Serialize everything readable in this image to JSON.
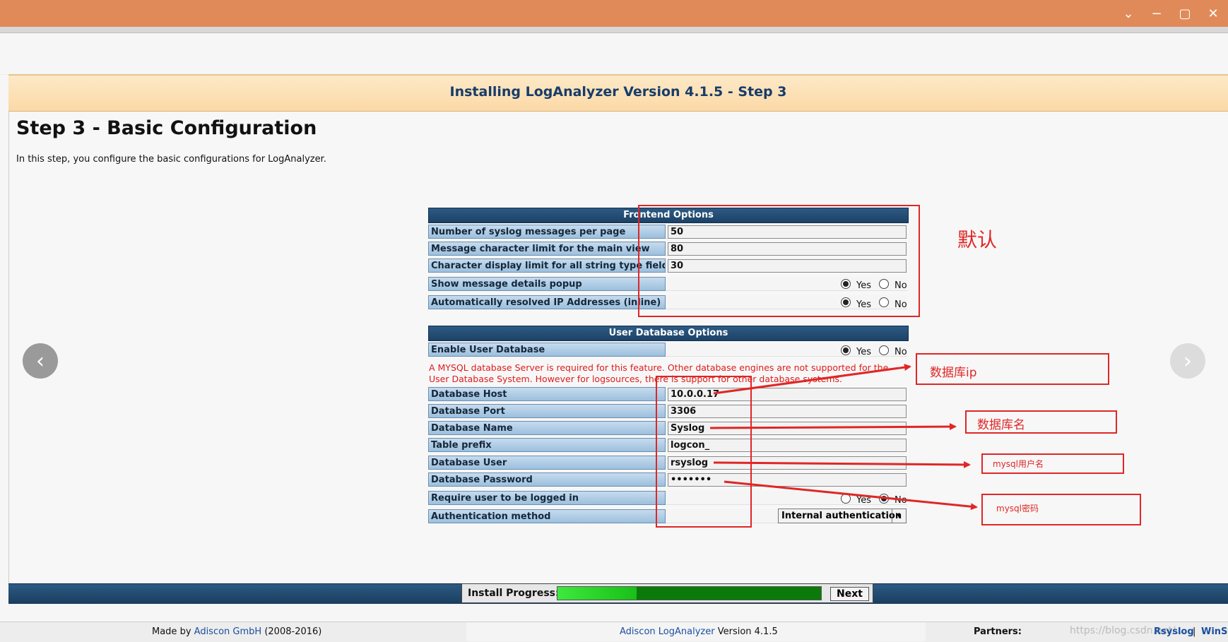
{
  "window": {
    "minimize_icon": "−",
    "restore_icon": "▢",
    "close_icon": "✕",
    "collapse_icon": "⌄"
  },
  "header": {
    "title": "Installing LogAnalyzer Version 4.1.5 - Step 3"
  },
  "page": {
    "heading": "Step 3 - Basic Configuration",
    "intro": "In this step, you configure the basic configurations for LogAnalyzer."
  },
  "frontend": {
    "title": "Frontend Options",
    "rows": [
      {
        "label": "Number of syslog messages per page",
        "value": "50"
      },
      {
        "label": "Message character limit for the main view",
        "value": "80"
      },
      {
        "label": "Character display limit for all string type fields",
        "value": "30"
      }
    ],
    "popup": {
      "label": "Show message details popup",
      "selected": "Yes"
    },
    "resolve": {
      "label": "Automatically resolved IP Addresses (inline)",
      "selected": "Yes"
    },
    "yes": "Yes",
    "no": "No"
  },
  "userdb": {
    "title": "User Database Options",
    "enable": {
      "label": "Enable User Database",
      "selected": "Yes"
    },
    "warning": "A MYSQL database Server is required for this feature. Other database engines are not supported for the User Database System. However for logsources, there is support for other database systems.",
    "rows": [
      {
        "label": "Database Host",
        "value": "10.0.0.17"
      },
      {
        "label": "Database Port",
        "value": "3306"
      },
      {
        "label": "Database Name",
        "value": "Syslog"
      },
      {
        "label": "Table prefix",
        "value": "logcon_"
      },
      {
        "label": "Database User",
        "value": "rsyslog"
      },
      {
        "label": "Database Password",
        "value": "•••••••"
      }
    ],
    "require": {
      "label": "Require user to be logged in",
      "selected": "No"
    },
    "auth": {
      "label": "Authentication method",
      "value": "Internal authentication"
    }
  },
  "progress": {
    "label": "Install Progress:",
    "fraction": 0.3,
    "next_label": "Next"
  },
  "footer": {
    "made_by_prefix": "Made by",
    "company": "Adiscon GmbH",
    "years": "(2008-2016)",
    "product": "Adiscon LogAnalyzer",
    "version": "Version 4.1.5",
    "partners_label": "Partners:",
    "partner1": "Rsyslog",
    "separator": "|",
    "partner2": "WinSy",
    "watermark": "https://blog.csdn.net/..."
  },
  "annotations": {
    "default_label": "默认",
    "db_ip": "数据库ip",
    "db_name": "数据库名",
    "mysql_user": "mysql用户名",
    "mysql_pass": "mysql密码"
  },
  "nav": {
    "prev_icon": "‹",
    "next_icon": "›"
  },
  "colors": {
    "titlebar": "#e08a5a",
    "annotation": "#e02626",
    "progress": "#18c018"
  }
}
